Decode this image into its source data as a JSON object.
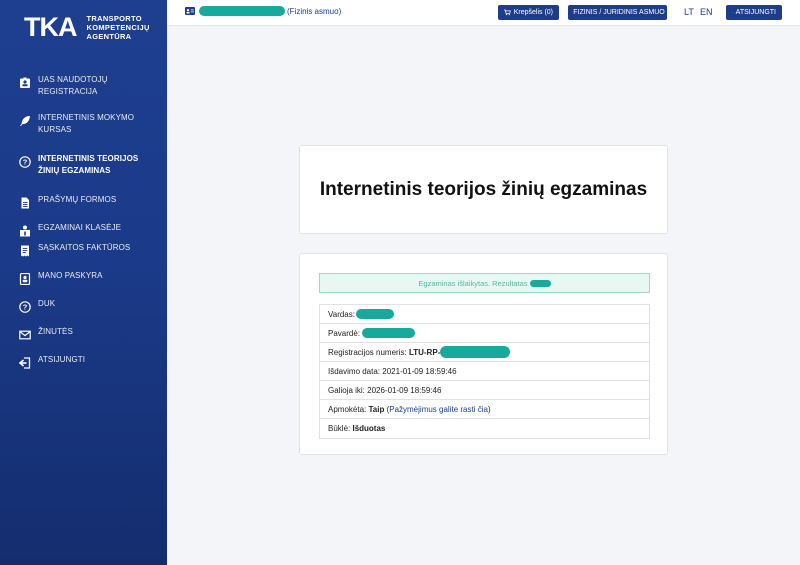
{
  "brand": {
    "logo_mark": "TKA",
    "logo_lines": [
      "Transporto",
      "kompetencijų",
      "agentūra"
    ]
  },
  "sidebar": {
    "items": [
      {
        "label_line1": "UAS naudotojų",
        "label_line2": "registracija",
        "icon": "id-badge-icon",
        "active": false
      },
      {
        "label_line1": "Internetinis mokymo",
        "label_line2": "kursas",
        "icon": "feather-icon",
        "active": false
      },
      {
        "label_line1": "Internetinis teorijos",
        "label_line2": "žinių egzaminas",
        "icon": "question-circle-icon",
        "active": true
      },
      {
        "label_line1": "Prašymų formos",
        "label_line2": "",
        "icon": "document-icon",
        "active": false
      },
      {
        "label_line1": "Egzaminai klasėje",
        "label_line2": "",
        "icon": "classroom-icon",
        "active": false
      },
      {
        "label_line1": "Sąskaitos faktūros",
        "label_line2": "",
        "icon": "receipt-icon",
        "active": false
      },
      {
        "label_line1": "Mano paskyra",
        "label_line2": "",
        "icon": "account-icon",
        "active": false
      },
      {
        "label_line1": "DUK",
        "label_line2": "",
        "icon": "question-circle-icon",
        "active": false
      },
      {
        "label_line1": "Žinutės",
        "label_line2": "",
        "icon": "envelope-icon",
        "active": false
      },
      {
        "label_line1": "Atsijungti",
        "label_line2": "",
        "icon": "logout-icon",
        "active": false
      }
    ]
  },
  "topbar": {
    "user_type": "(Fizinis asmuo)",
    "cart_label": "Krepšelis (0)",
    "switch_label": "FIZINIS / JURIDINIS ASMUO",
    "lang_lt": "LT",
    "lang_en": "EN",
    "logout_label": "ATSIJUNGTI"
  },
  "main": {
    "title": "Internetinis teorijos žinių egzaminas",
    "result_text": "Egzaminas išlaikytas. Rezultatas",
    "rows": {
      "vardas_label": "Vardas:",
      "pavarde_label": "Pavardė:",
      "reg_label": "Registracijos numeris:",
      "reg_prefix": "LTU-RP-",
      "issue_label": "Išdavimo data:",
      "issue_value": "2021-01-09 18:59:46",
      "valid_label": "Galioja iki:",
      "valid_value": "2026-01-09 18:59:46",
      "paid_label": "Apmokėta:",
      "paid_value": "Taip",
      "paid_link": "Pažymėjimus galite rasti čia",
      "state_label": "Būklė:",
      "state_value": "Išduotas"
    }
  },
  "colors": {
    "sidebar": "#1b3a89",
    "accent": "#1d3d8c",
    "redaction": "#17a99c",
    "success_bg": "#e9f7f3"
  }
}
